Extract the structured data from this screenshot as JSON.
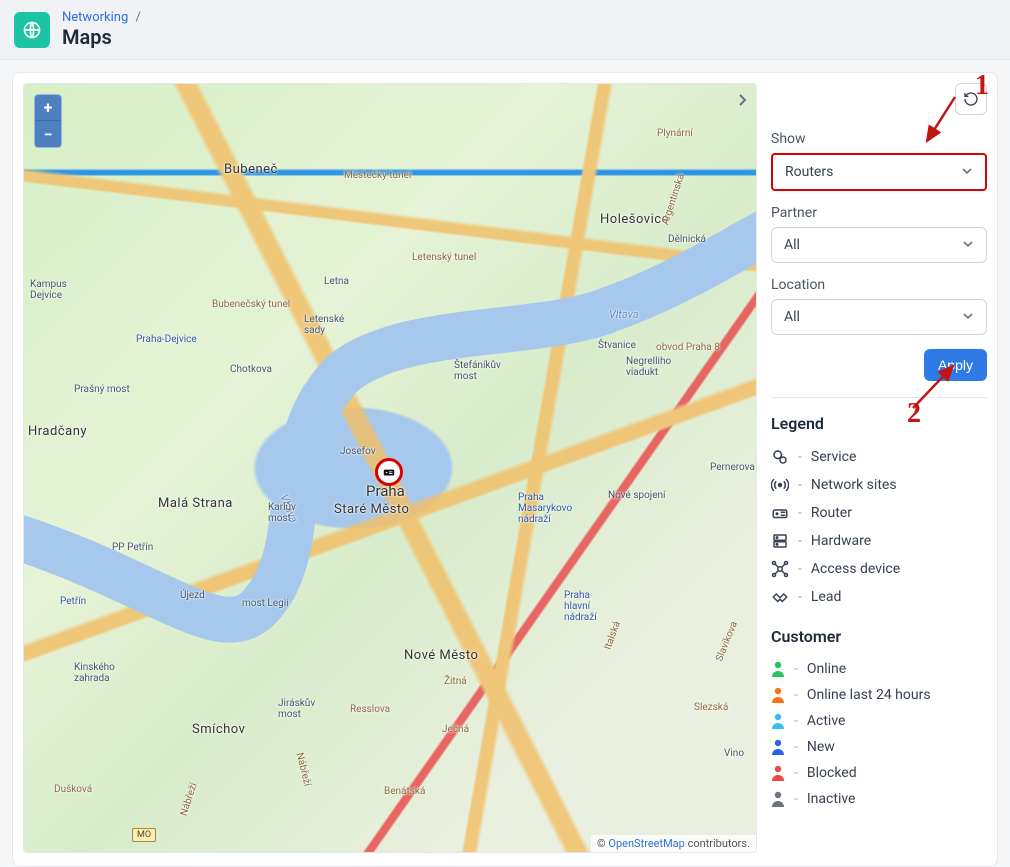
{
  "header": {
    "breadcrumb_root": "Networking",
    "breadcrumb_sep": "/",
    "title": "Maps"
  },
  "map": {
    "zoom_in": "+",
    "zoom_out": "−",
    "attribution_prefix": "© ",
    "attribution_link": "OpenStreetMap",
    "attribution_suffix": " contributors.",
    "scale_badge": "MO",
    "labels": {
      "praha": "Praha",
      "bubenec": "Bubeneč",
      "holesovice": "Holešovice",
      "josefov": "Josefov",
      "mala_strana": "Malá Strana",
      "stare_mesto": "Staré Město",
      "nove_mesto": "Nové Město",
      "hradcany": "Hradčany",
      "smichov": "Smíchov",
      "ujezd": "Újezd",
      "petrin": "Petřín",
      "delnicka": "Dělnická",
      "kampus": "Kampus\nDejvice",
      "praha_dejvice": "Praha-Dejvice",
      "letenske": "Letenské\nsady",
      "letna": "Letna",
      "pp_petrin": "PP Petřín",
      "kinskeho": "Kinského\nzahrada",
      "duskova": "Dušková",
      "plynarni": "Plynární",
      "stvanice": "Štvanice",
      "vltava": "Vltava",
      "vltava2": "Vltava",
      "stefanikuv": "Štefáníkův\nmost",
      "negrelli": "Negrelliho\nviadukt",
      "prasny": "Prašný most",
      "chotkova": "Chotkova",
      "most_legii": "most Legií",
      "jiraskuv": "Jiráskův\nmost",
      "karluv": "Karlův\nmost",
      "zitna": "Žitná",
      "resslova": "Resslova",
      "jecna": "Ječná",
      "benatska": "Benátská",
      "slezska": "Slezská",
      "italska": "Italská",
      "argentinska": "Argentinská",
      "bubenecky": "Bubenečský tunel",
      "letensky_tunel": "Letenský tunel",
      "mestecky_tunel": "Městečký tunel",
      "nabr1": "Nábřeží",
      "nabr2": "Nábřeží",
      "obvod": "obvod Praha 8",
      "masaryk": "Praha\nMasarykovo\nnádraží",
      "hlavni": "Praha\nhlavní\nnádraží",
      "nove_spojeni": "Nové spojení",
      "slavikova": "Slavíkova",
      "pernerova": "Pernerova",
      "vino": "Vino"
    }
  },
  "filters": {
    "show_label": "Show",
    "show_value": "Routers",
    "partner_label": "Partner",
    "partner_value": "All",
    "location_label": "Location",
    "location_value": "All",
    "apply": "Apply"
  },
  "legend": {
    "title": "Legend",
    "items": [
      {
        "label": "Service"
      },
      {
        "label": "Network sites"
      },
      {
        "label": "Router"
      },
      {
        "label": "Hardware"
      },
      {
        "label": "Access device"
      },
      {
        "label": "Lead"
      }
    ]
  },
  "customer": {
    "title": "Customer",
    "items": [
      {
        "label": "Online",
        "color": "#22c55e"
      },
      {
        "label": "Online last 24 hours",
        "color": "#f97316"
      },
      {
        "label": "Active",
        "color": "#38bdf8"
      },
      {
        "label": "New",
        "color": "#2563eb"
      },
      {
        "label": "Blocked",
        "color": "#ef4444"
      },
      {
        "label": "Inactive",
        "color": "#6b7280"
      }
    ]
  },
  "annotations": {
    "num1": "1",
    "num2": "2"
  }
}
